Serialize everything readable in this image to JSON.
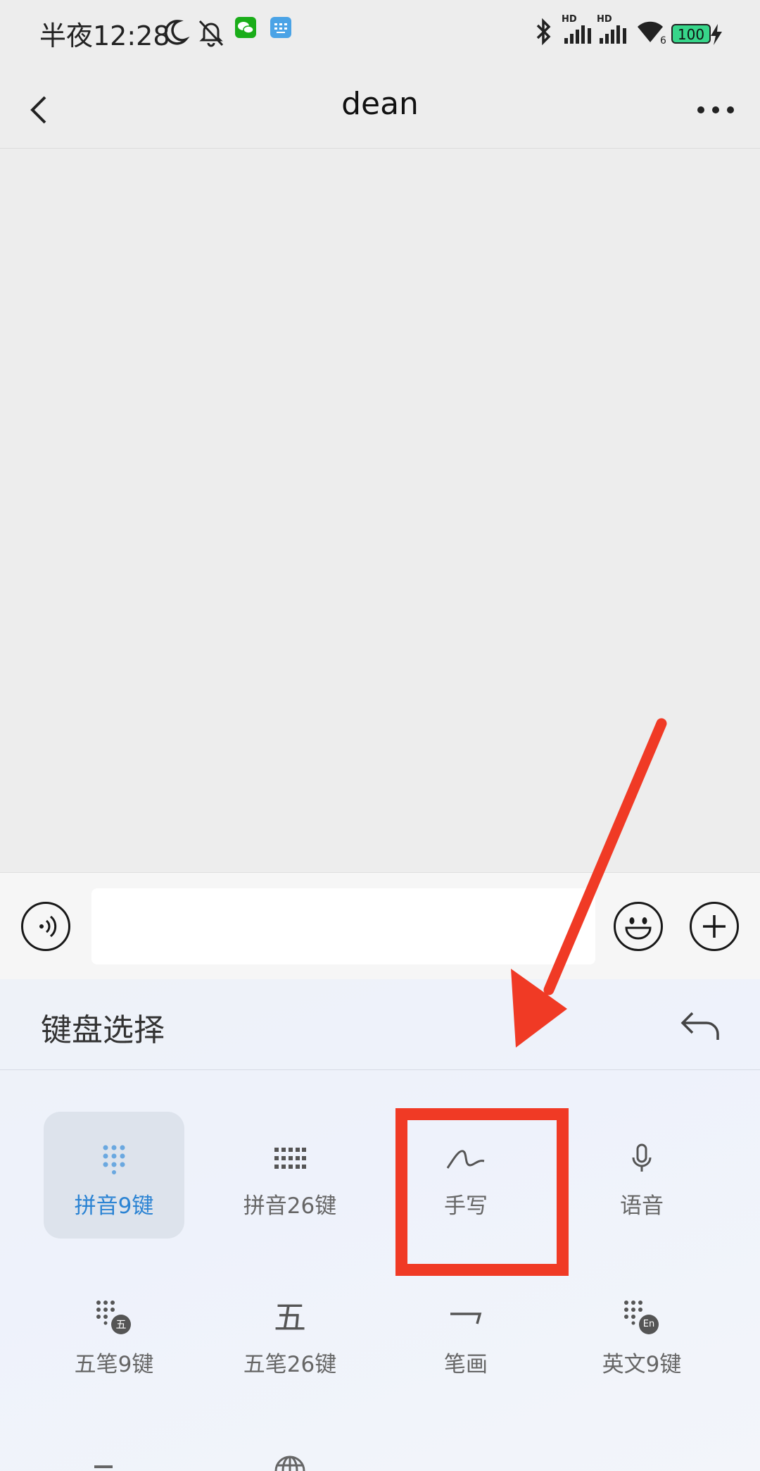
{
  "status_bar": {
    "time": "半夜12:28",
    "hd_label_1": "HD",
    "hd_label_2": "HD",
    "battery": "100",
    "signal_sub": "6"
  },
  "nav": {
    "title": "dean"
  },
  "input_bar": {
    "value": "",
    "placeholder": ""
  },
  "keyboard_panel": {
    "title": "键盘选择",
    "options": [
      {
        "label": "拼音9键",
        "icon": "pinyin-9-key-icon",
        "selected": true
      },
      {
        "label": "拼音26键",
        "icon": "pinyin-26-key-icon",
        "selected": false
      },
      {
        "label": "手写",
        "icon": "handwriting-icon",
        "selected": false
      },
      {
        "label": "语音",
        "icon": "microphone-icon",
        "selected": false
      },
      {
        "label": "五笔9键",
        "icon": "wubi-9-key-icon",
        "selected": false
      },
      {
        "label": "五笔26键",
        "icon": "wubi-26-key-icon",
        "selected": false
      },
      {
        "label": "笔画",
        "icon": "stroke-icon",
        "selected": false
      },
      {
        "label": "英文9键",
        "icon": "english-9-key-icon",
        "selected": false
      }
    ],
    "badge_wu": "五",
    "badge_en": "En",
    "wubi_glyph": "五"
  },
  "colors": {
    "accent": "#2b83d3",
    "annotation": "#f03a25",
    "wechat_green": "#1aad19"
  }
}
